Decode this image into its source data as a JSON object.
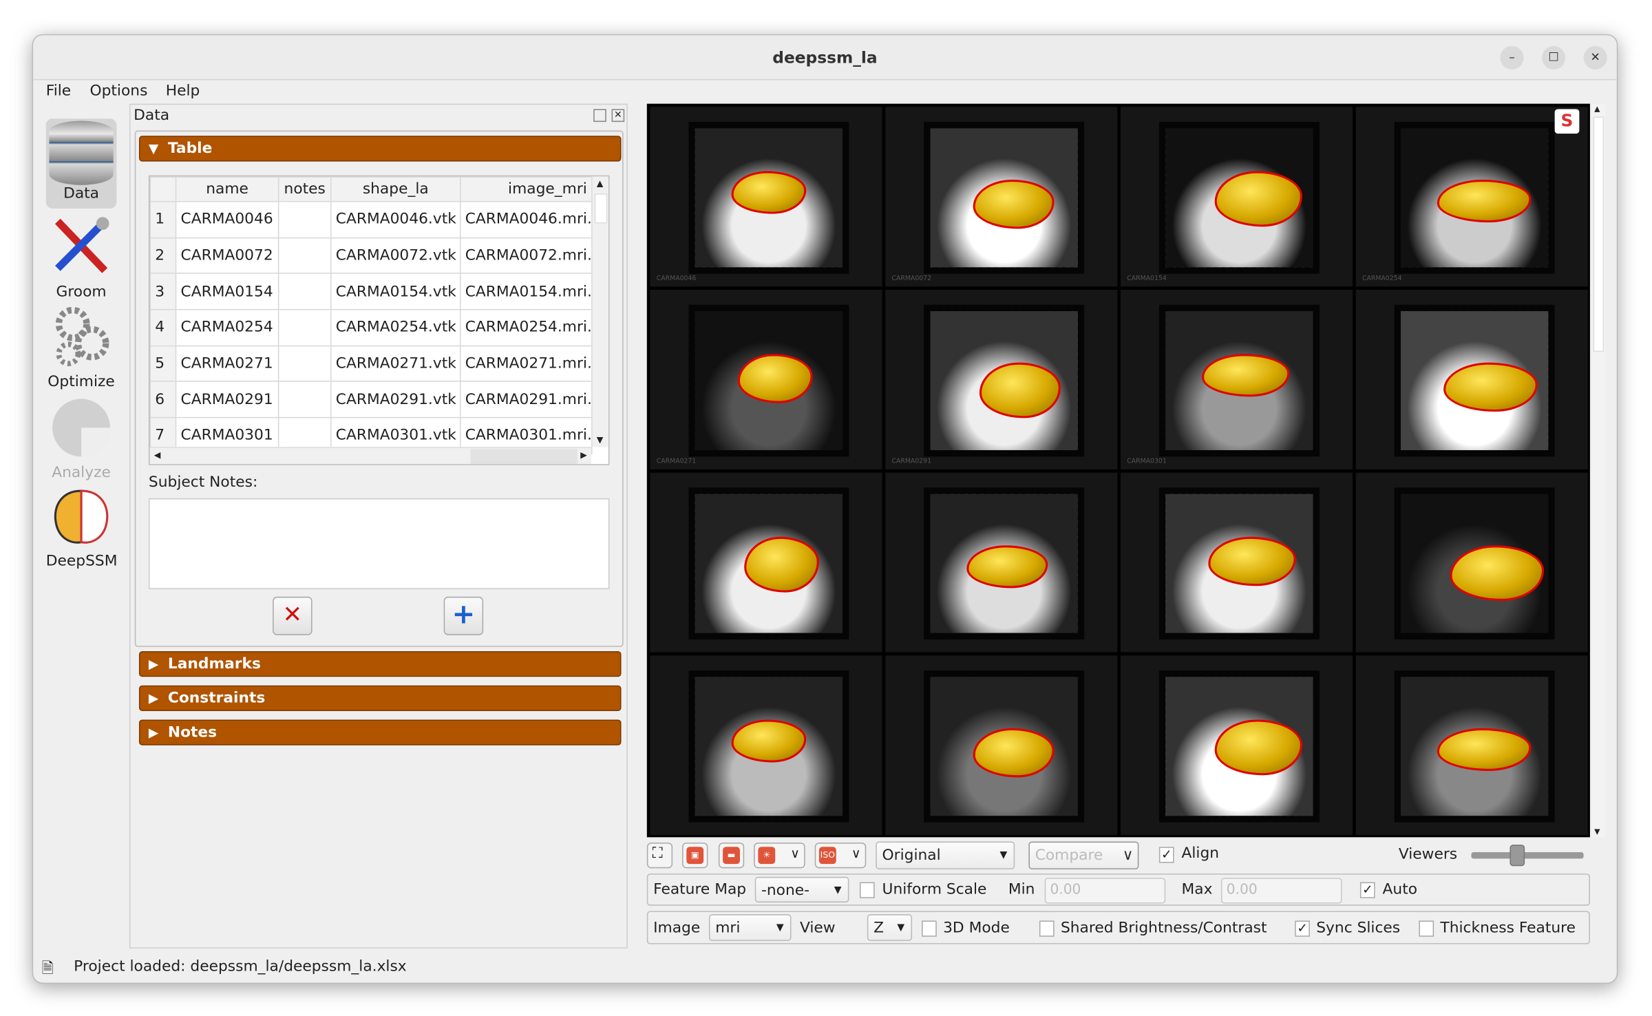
{
  "window": {
    "title": "deepssm_la"
  },
  "menu": [
    "File",
    "Options",
    "Help"
  ],
  "tools": [
    {
      "label": "Data",
      "icon": "database-icon",
      "active": true
    },
    {
      "label": "Groom",
      "icon": "tools-icon"
    },
    {
      "label": "Optimize",
      "icon": "gears-icon"
    },
    {
      "label": "Analyze",
      "icon": "pie-chart-icon",
      "disabled": true
    },
    {
      "label": "DeepSSM",
      "icon": "brain-icon"
    }
  ],
  "dock": {
    "title": "Data"
  },
  "sections": {
    "table": "Table",
    "landmarks": "Landmarks",
    "constraints": "Constraints",
    "notes": "Notes"
  },
  "table": {
    "columns": [
      "name",
      "notes",
      "shape_la",
      "image_mri"
    ],
    "rows": [
      [
        "1",
        "CARMA0046",
        "",
        "CARMA0046.vtk",
        "CARMA0046.mri."
      ],
      [
        "2",
        "CARMA0072",
        "",
        "CARMA0072.vtk",
        "CARMA0072.mri."
      ],
      [
        "3",
        "CARMA0154",
        "",
        "CARMA0154.vtk",
        "CARMA0154.mri."
      ],
      [
        "4",
        "CARMA0254",
        "",
        "CARMA0254.vtk",
        "CARMA0254.mri."
      ],
      [
        "5",
        "CARMA0271",
        "",
        "CARMA0271.vtk",
        "CARMA0271.mri."
      ],
      [
        "6",
        "CARMA0291",
        "",
        "CARMA0291.vtk",
        "CARMA0291.mri."
      ],
      [
        "7",
        "CARMA0301",
        "",
        "CARMA0301.vtk",
        "CARMA0301.mri."
      ]
    ]
  },
  "subject_notes": {
    "label": "Subject Notes:",
    "value": ""
  },
  "viewer": {
    "labels": [
      "CARMA0046",
      "CARMA0072",
      "CARMA0154",
      "CARMA0254",
      "CARMA0271",
      "CARMA0291",
      "CARMA0301"
    ],
    "accent": "#d6a800",
    "outline": "#e00000"
  },
  "toolbar": {
    "display_mode": "Original",
    "compare": "Compare",
    "align": {
      "label": "Align",
      "checked": true
    },
    "viewers_label": "Viewers",
    "viewers_level": 0.4
  },
  "feature_row": {
    "feature_map_label": "Feature Map",
    "feature_map": "-none-",
    "uniform_scale": "Uniform Scale",
    "min_label": "Min",
    "min": "0.00",
    "max_label": "Max",
    "max": "0.00",
    "auto": "Auto"
  },
  "image_row": {
    "image_label": "Image",
    "image": "mri",
    "view_label": "View",
    "view": "Z",
    "mode3d": "3D Mode",
    "shared": "Shared Brightness/Contrast",
    "sync": "Sync Slices",
    "thickness": "Thickness Feature"
  },
  "status": {
    "text": "Project loaded: deepssm_la/deepssm_la.xlsx"
  }
}
